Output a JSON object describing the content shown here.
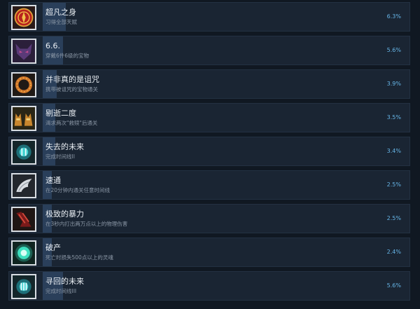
{
  "achievements": [
    {
      "title": "超凡之身",
      "description": "习得全部天赋",
      "percent_label": "6.3%",
      "percent": 6.3,
      "icon": "red-emblem-icon"
    },
    {
      "title": "6.6.",
      "description": "穿戴6件6级的宝物",
      "percent_label": "5.6%",
      "percent": 5.6,
      "icon": "demon-mask-icon"
    },
    {
      "title": "并非真的是诅咒",
      "description": "携带被诅咒的宝物通关",
      "percent_label": "3.9%",
      "percent": 3.9,
      "icon": "cursed-ring-icon"
    },
    {
      "title": "剔逝二度",
      "description": "渴求两次\"救赎\"后通关",
      "percent_label": "3.5%",
      "percent": 3.5,
      "icon": "twin-foxes-icon"
    },
    {
      "title": "失去的未来",
      "description": "完成时间线II",
      "percent_label": "3.4%",
      "percent": 3.4,
      "icon": "time-crystal-icon"
    },
    {
      "title": "速通",
      "description": "在20分钟内通关任意时间线",
      "percent_label": "2.5%",
      "percent": 2.5,
      "icon": "wing-icon"
    },
    {
      "title": "极致的暴力",
      "description": "在3秒内打出两万点以上的物理伤害",
      "percent_label": "2.5%",
      "percent": 2.5,
      "icon": "bloody-claw-icon"
    },
    {
      "title": "破产",
      "description": "死亡时损失500点以上的灵魂",
      "percent_label": "2.4%",
      "percent": 2.4,
      "icon": "soul-orb-icon"
    },
    {
      "title": "寻回的未来",
      "description": "完成时间线III",
      "percent_label": "5.6%",
      "percent": 5.6,
      "icon": "time-crystal-icon"
    }
  ],
  "colors": {
    "row_bg": "#1a2533",
    "fill": "#2a3f5a",
    "title": "#e9eef3",
    "desc": "#8b97a6",
    "percent": "#67b6e8"
  }
}
